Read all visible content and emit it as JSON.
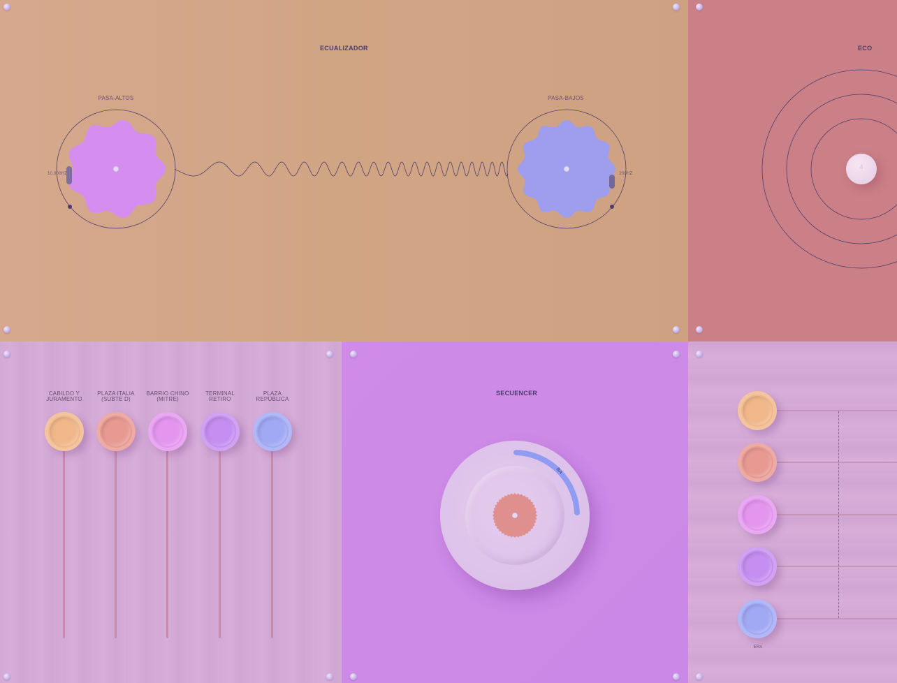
{
  "equalizer": {
    "title": "ECUALIZADOR",
    "highpass_label": "PASA-ALTOS",
    "lowpass_label": "PASA-BAJOS",
    "highpass_freq": "10.000HZ",
    "lowpass_freq": "200HZ",
    "colors": {
      "background": "#d4a383",
      "highpass_knob": "#d58ef0",
      "lowpass_knob": "#9f9ded"
    }
  },
  "echo": {
    "title": "ECO",
    "knob_glyph": "4",
    "colors": {
      "background": "#cb8087",
      "knob": "#ecd4ea"
    }
  },
  "stations": {
    "items": [
      {
        "line1": "CABILDO Y",
        "line2": "JURAMENTO",
        "color": "#f0b88a"
      },
      {
        "line1": "PLAZA ITALIA",
        "line2": "(SUBTE D)",
        "color": "#e89a92"
      },
      {
        "line1": "BARRIO CHINO",
        "line2": "(MITRE)",
        "color": "#e496ef"
      },
      {
        "line1": "TERMINAL",
        "line2": "RETIRO",
        "color": "#c58ef0"
      },
      {
        "line1": "PLAZA",
        "line2": "REPÚBLICA",
        "color": "#a2a9f4"
      }
    ],
    "colors": {
      "background": "#d4aad6"
    }
  },
  "sequencer": {
    "title": "SECUENCER",
    "arc_label": "BA",
    "colors": {
      "background": "#cc89e6",
      "disc": "#e4c8ec",
      "center": "#e08f8f",
      "arc": "#8f9cf2"
    }
  },
  "right_bottom": {
    "caption": "ERA",
    "buttons": [
      "#f0b88a",
      "#e89a92",
      "#e496ef",
      "#c58ef0",
      "#a2a9f4"
    ],
    "colors": {
      "background": "#d4a9d6"
    }
  }
}
